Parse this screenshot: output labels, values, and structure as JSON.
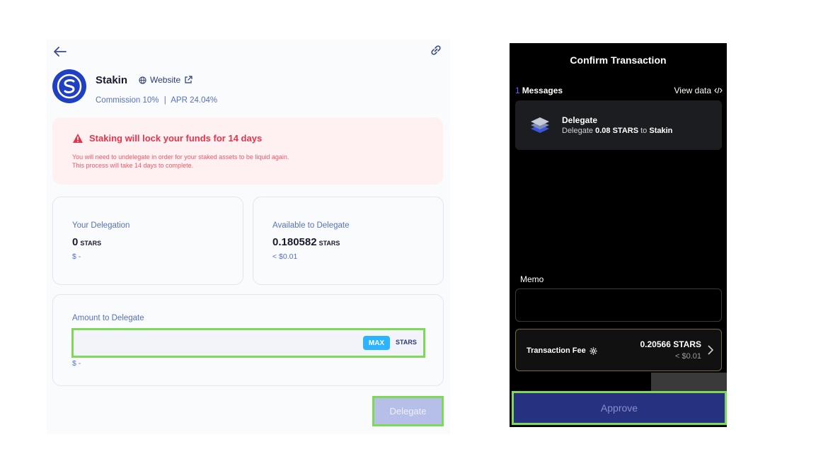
{
  "staking": {
    "validator_name": "Stakin",
    "website_label": "Website",
    "commission": "Commission 10%",
    "separator": "|",
    "apr": "APR 24.04%",
    "warning_title": "Staking will lock your funds for 14 days",
    "warning_line1": "You will need to undelegate in order for your staked assets to be liquid again.",
    "warning_line2": "This process will take 14 days to complete.",
    "your_delegation": {
      "label": "Your Delegation",
      "value": "0",
      "unit": "STARS",
      "usd": "$ -"
    },
    "available": {
      "label": "Available to Delegate",
      "value": "0.180582",
      "unit": "STARS",
      "usd": "< $0.01"
    },
    "amount": {
      "label": "Amount to Delegate",
      "value": "",
      "max_label": "MAX",
      "unit": "STARS",
      "usd": "$ -"
    },
    "delegate_button": "Delegate"
  },
  "confirm": {
    "title": "Confirm Transaction",
    "messages_count": "1",
    "messages_label": "Messages",
    "view_data": "View data",
    "message": {
      "title": "Delegate",
      "desc_prefix": "Delegate",
      "amount": "0.08 STARS",
      "desc_mid": "to",
      "target": "Stakin"
    },
    "memo_label": "Memo",
    "memo_value": "",
    "fee_label": "Transaction Fee",
    "fee_value": "0.20566 STARS",
    "fee_usd": "< $0.01",
    "approve_button": "Approve"
  },
  "colors": {
    "accent": "#1f3fc4",
    "warning": "#e8334a",
    "max": "#2bb4ff",
    "highlight": "#7ed957",
    "approve": "#26317f"
  },
  "icons": [
    "back-arrow-icon",
    "link-icon",
    "globe-icon",
    "external-link-icon",
    "warning-triangle-icon",
    "layers-icon",
    "code-icon",
    "gear-icon",
    "chevron-right-icon"
  ]
}
